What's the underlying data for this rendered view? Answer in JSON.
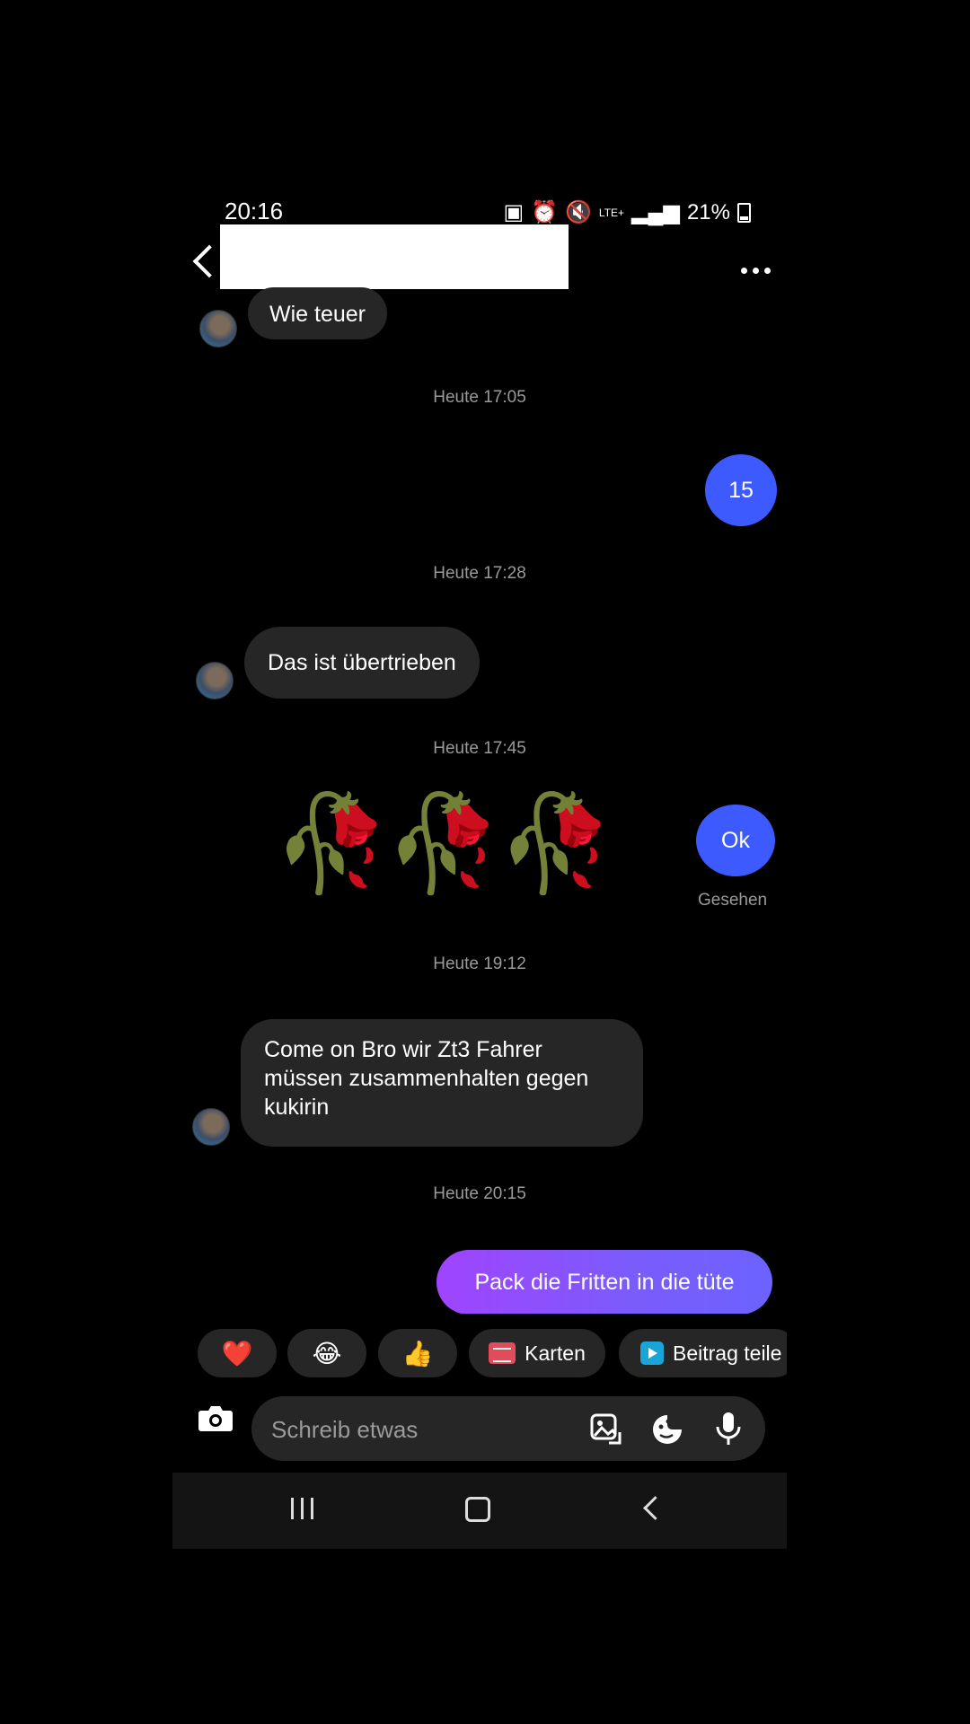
{
  "status_bar": {
    "time": "20:16",
    "network": "LTE+",
    "battery": "21%"
  },
  "chat": {
    "messages": [
      {
        "id": "m1",
        "side": "in",
        "text": "Wie teuer"
      },
      {
        "id": "t1",
        "type": "timestamp",
        "text": "Heute 17:05"
      },
      {
        "id": "m2",
        "side": "out",
        "text": "15"
      },
      {
        "id": "t2",
        "type": "timestamp",
        "text": "Heute 17:28"
      },
      {
        "id": "m3",
        "side": "in",
        "text": "Das ist übertrieben"
      },
      {
        "id": "t3",
        "type": "timestamp",
        "text": "Heute 17:45"
      },
      {
        "id": "m4",
        "side": "in",
        "type": "emoji",
        "text": "🥀🥀🥀"
      },
      {
        "id": "m5",
        "side": "out",
        "text": "Ok"
      },
      {
        "id": "seen",
        "text": "Gesehen"
      },
      {
        "id": "t4",
        "type": "timestamp",
        "text": "Heute 19:12"
      },
      {
        "id": "m6",
        "side": "in",
        "text": "Come on Bro wir Zt3 Fahrer müssen zusammenhalten gegen kukirin"
      },
      {
        "id": "t5",
        "type": "timestamp",
        "text": "Heute 20:15"
      },
      {
        "id": "m7",
        "side": "out",
        "text": "Pack die Fritten in die tüte"
      }
    ]
  },
  "quick_replies": {
    "heart": "❤️",
    "laugh": "😂",
    "thumbs": "👍",
    "karten": "Karten",
    "beitrag": "Beitrag teile"
  },
  "composer": {
    "placeholder": "Schreib etwas"
  },
  "icons": {
    "back": "chevron-left-icon",
    "more": "more-horizontal-icon",
    "camera": "camera-icon",
    "gallery": "gallery-icon",
    "sticker": "sticker-icon",
    "mic": "microphone-icon"
  },
  "colors": {
    "outgoing_bubble": "#3d5afe",
    "incoming_bubble": "#262626",
    "gradient_start": "#a044ff",
    "gradient_end": "#6c63ff"
  }
}
